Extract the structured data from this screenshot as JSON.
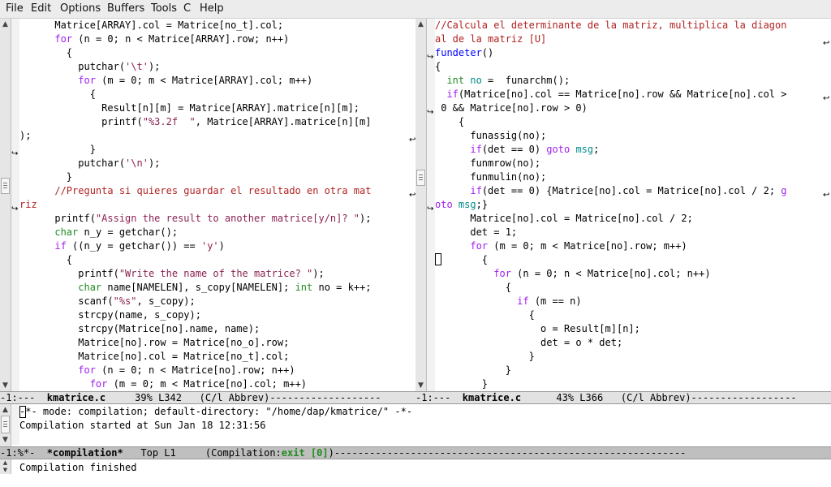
{
  "menubar": {
    "items": [
      "File",
      "Edit",
      "Options",
      "Buffers",
      "Tools",
      "C",
      "Help"
    ]
  },
  "left_window": {
    "lines": [
      [
        [
          "n",
          "      Matrice[ARRAY].col = Matrice[no_t].col;"
        ]
      ],
      [
        [
          "n",
          "      "
        ],
        [
          "kw",
          "for"
        ],
        [
          "n",
          " (n = 0; n < Matrice[ARRAY].row; n++)"
        ]
      ],
      [
        [
          "n",
          "        {"
        ]
      ],
      [
        [
          "n",
          "          putchar("
        ],
        [
          "st",
          "'\\t'"
        ],
        [
          "n",
          ");"
        ]
      ],
      [
        [
          "n",
          "          "
        ],
        [
          "kw",
          "for"
        ],
        [
          "n",
          " (m = 0; m < Matrice[ARRAY].col; m++)"
        ]
      ],
      [
        [
          "n",
          "            {"
        ]
      ],
      [
        [
          "n",
          "              Result[n][m] = Matrice[ARRAY].matrice[n][m];"
        ]
      ],
      [
        [
          "n",
          "              printf("
        ],
        [
          "st",
          "\"%3.2f  \""
        ],
        [
          "n",
          ", Matrice[ARRAY].matrice[n][m]"
        ]
      ],
      [
        [
          "n",
          ");"
        ]
      ],
      [
        [
          "n",
          "            }"
        ]
      ],
      [
        [
          "n",
          "          putchar("
        ],
        [
          "st",
          "'\\n'"
        ],
        [
          "n",
          ");"
        ]
      ],
      [
        [
          "n",
          "        }"
        ]
      ],
      [
        [
          "cm",
          "      //Pregunta si quieres guardar el resultado en otra mat"
        ]
      ],
      [
        [
          "cm",
          "riz"
        ]
      ],
      [
        [
          "n",
          "      printf("
        ],
        [
          "st",
          "\"Assign the result to another matrice[y/n]? \""
        ],
        [
          "n",
          ");"
        ]
      ],
      [
        [
          "n",
          "      "
        ],
        [
          "ty",
          "char"
        ],
        [
          "n",
          " n_y = getchar();"
        ]
      ],
      [
        [
          "n",
          "      "
        ],
        [
          "kw",
          "if"
        ],
        [
          "n",
          " ((n_y = getchar()) == "
        ],
        [
          "st",
          "'y'"
        ],
        [
          "n",
          ")"
        ]
      ],
      [
        [
          "n",
          "        {"
        ]
      ],
      [
        [
          "n",
          "          printf("
        ],
        [
          "st",
          "\"Write the name of the matrice? \""
        ],
        [
          "n",
          ");"
        ]
      ],
      [
        [
          "n",
          "          "
        ],
        [
          "ty",
          "char"
        ],
        [
          "n",
          " name[NAMELEN], s_copy[NAMELEN]; "
        ],
        [
          "ty",
          "int"
        ],
        [
          "n",
          " no = k++;"
        ]
      ],
      [
        [
          "n",
          "          scanf("
        ],
        [
          "st",
          "\"%s\""
        ],
        [
          "n",
          ", s_copy);"
        ]
      ],
      [
        [
          "n",
          "          strcpy(name, s_copy);"
        ]
      ],
      [
        [
          "n",
          "          strcpy(Matrice[no].name, name);"
        ]
      ],
      [
        [
          "n",
          "          Matrice[no].row = Matrice[no_o].row;"
        ]
      ],
      [
        [
          "n",
          "          Matrice[no].col = Matrice[no_t].col;"
        ]
      ],
      [
        [
          "n",
          "          "
        ],
        [
          "kw",
          "for"
        ],
        [
          "n",
          " (n = 0; n < Matrice[no].row; n++)"
        ]
      ],
      [
        [
          "n",
          "            "
        ],
        [
          "kw",
          "for"
        ],
        [
          "n",
          " (m = 0; m < Matrice[no].col; m++)"
        ]
      ]
    ],
    "modeline": {
      "prefix": "-1:---  ",
      "buffer": "kmatrice.c",
      "suffix": "     39% L342   (C/l Abbrev)-------------------"
    }
  },
  "right_window": {
    "lines": [
      [
        [
          "cm",
          "//Calcula el determinante de la matriz, multiplica la diagon"
        ]
      ],
      [
        [
          "cm",
          "al de la matriz [U]"
        ]
      ],
      [
        [
          "fn",
          "fundeter"
        ],
        [
          "n",
          "()"
        ]
      ],
      [
        [
          "n",
          "{"
        ]
      ],
      [
        [
          "n",
          "  "
        ],
        [
          "ty",
          "int"
        ],
        [
          "n",
          " "
        ],
        [
          "cs",
          "no"
        ],
        [
          "n",
          " =  funarchm();"
        ]
      ],
      [
        [
          "n",
          "  "
        ],
        [
          "kw",
          "if"
        ],
        [
          "n",
          "(Matrice[no].col == Matrice[no].row && Matrice[no].col >"
        ]
      ],
      [
        [
          "n",
          " 0 && Matrice[no].row > 0)"
        ]
      ],
      [
        [
          "n",
          "    {"
        ]
      ],
      [
        [
          "n",
          "      funassig(no);"
        ]
      ],
      [
        [
          "n",
          "      "
        ],
        [
          "kw",
          "if"
        ],
        [
          "n",
          "(det == 0) "
        ],
        [
          "kw",
          "goto"
        ],
        [
          "n",
          " "
        ],
        [
          "cs",
          "msg"
        ],
        [
          "n",
          ";"
        ]
      ],
      [
        [
          "n",
          "      funmrow(no);"
        ]
      ],
      [
        [
          "n",
          "      funmulin(no);"
        ]
      ],
      [
        [
          "n",
          "      "
        ],
        [
          "kw",
          "if"
        ],
        [
          "n",
          "(det == 0) {Matrice[no].col = Matrice[no].col / 2; "
        ],
        [
          "kw",
          "g"
        ]
      ],
      [
        [
          "kw",
          "oto"
        ],
        [
          "n",
          " "
        ],
        [
          "cs",
          "msg"
        ],
        [
          "n",
          ";}"
        ]
      ],
      [
        [
          "n",
          "      Matrice[no].col = Matrice[no].col / 2;"
        ]
      ],
      [
        [
          "n",
          "      det = 1;"
        ]
      ],
      [
        [
          "n",
          "      "
        ],
        [
          "kw",
          "for"
        ],
        [
          "n",
          " (m = 0; m < Matrice[no].row; m++)"
        ]
      ],
      [
        [
          "n",
          "        {"
        ]
      ],
      [
        [
          "n",
          "          "
        ],
        [
          "kw",
          "for"
        ],
        [
          "n",
          " (n = 0; n < Matrice[no].col; n++)"
        ]
      ],
      [
        [
          "n",
          "            {"
        ]
      ],
      [
        [
          "n",
          "              "
        ],
        [
          "kw",
          "if"
        ],
        [
          "n",
          " (m == n)"
        ]
      ],
      [
        [
          "n",
          "                {"
        ]
      ],
      [
        [
          "n",
          "                  o = Result[m][n];"
        ]
      ],
      [
        [
          "n",
          "                  det = o * det;"
        ]
      ],
      [
        [
          "n",
          "                }"
        ]
      ],
      [
        [
          "n",
          "            }"
        ]
      ],
      [
        [
          "n",
          "        }"
        ]
      ]
    ],
    "modeline": {
      "prefix": "-1:---  ",
      "buffer": "kmatrice.c",
      "suffix": "      43% L366   (C/l Abbrev)------------------"
    }
  },
  "compilation": {
    "line1": "-*- mode: compilation; default-directory: \"/home/dap/kmatrice/\" -*-",
    "line2": "Compilation started at Sun Jan 18 12:31:56",
    "modeline": {
      "prefix": "-1:%*-  ",
      "buffer": "*compilation*",
      "mid": "   Top L1     (Compilation:",
      "status": "exit [0]",
      "suffix": ")------------------------------------------------------------"
    }
  },
  "echo_area": {
    "text": "Compilation finished"
  },
  "icons": [
    "scroll-up-arrow-icon",
    "scroll-down-arrow-icon",
    "continuation-arrow-icon",
    "wrap-arrow-icon",
    "cursor-box"
  ]
}
